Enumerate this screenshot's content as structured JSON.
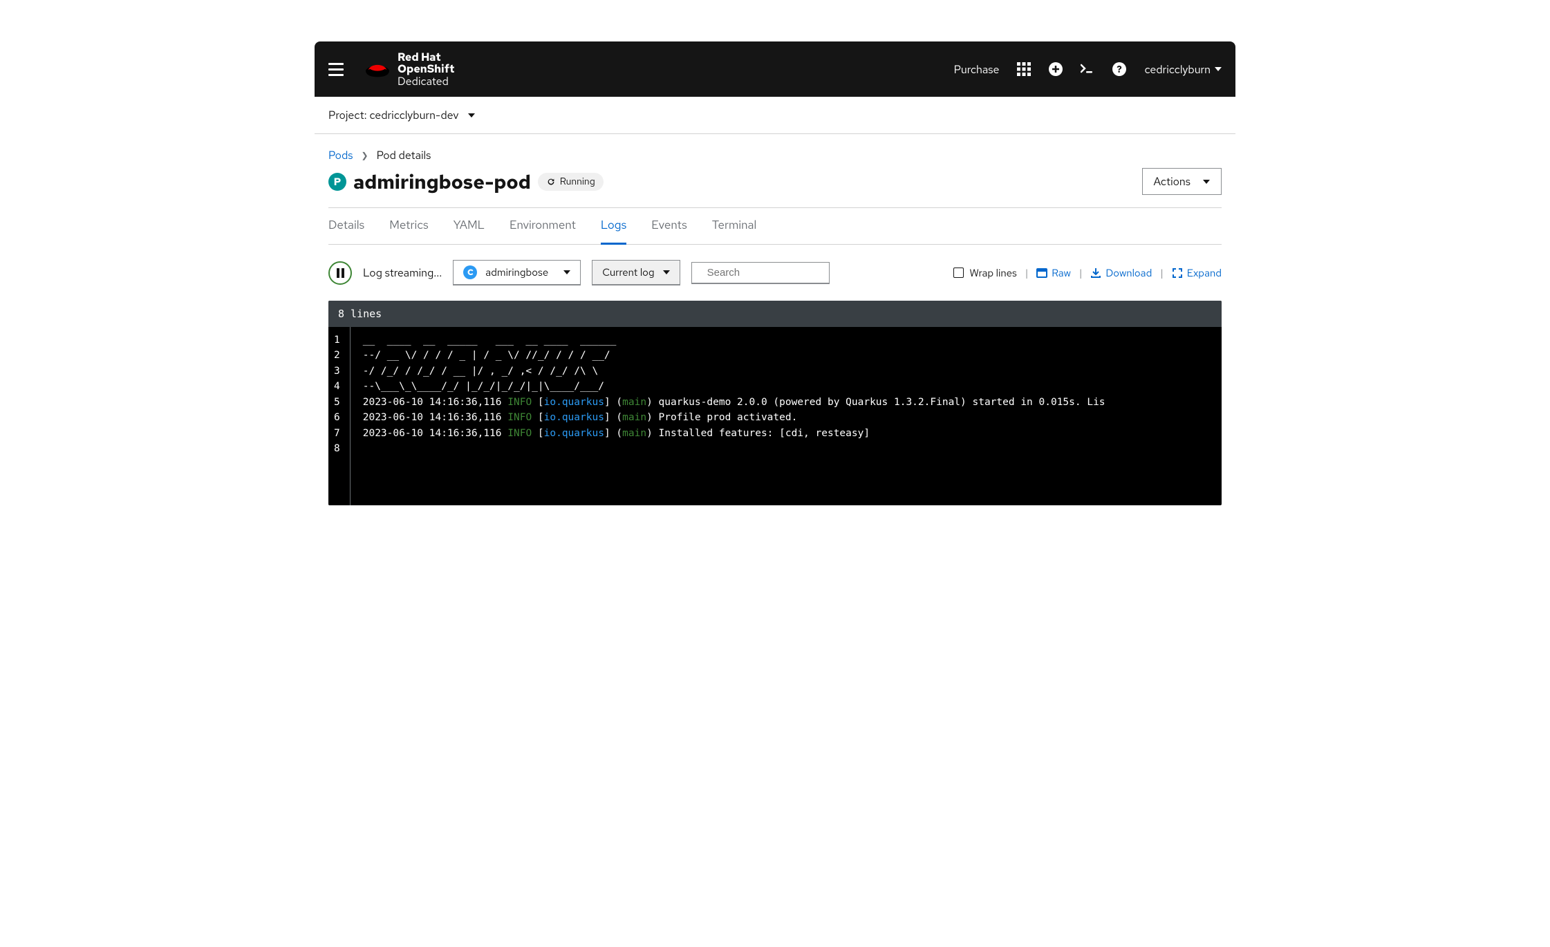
{
  "masthead": {
    "brand_l1": "Red Hat",
    "brand_l2": "OpenShift",
    "brand_l3": "Dedicated",
    "purchase": "Purchase",
    "username": "cedricclyburn"
  },
  "project": {
    "label": "Project: cedricclyburn-dev"
  },
  "breadcrumb": {
    "root": "Pods",
    "current": "Pod details"
  },
  "heading": {
    "badge": "P",
    "title": "admiringbose-pod",
    "status": "Running",
    "actions": "Actions"
  },
  "tabs": {
    "details": "Details",
    "metrics": "Metrics",
    "yaml": "YAML",
    "environment": "Environment",
    "logs": "Logs",
    "events": "Events",
    "terminal": "Terminal"
  },
  "log_toolbar": {
    "streaming": "Log streaming...",
    "container_badge": "C",
    "container_name": "admiringbose",
    "current_log": "Current log",
    "search_placeholder": "Search",
    "wrap": "Wrap lines",
    "raw": "Raw",
    "download": "Download",
    "expand": "Expand"
  },
  "log": {
    "line_count_label": "8 lines",
    "lines": [
      {
        "n": "1",
        "segments": [
          {
            "cls": "tok-plain",
            "t": "__  ____  __  _____   ___  __ ____  ______"
          }
        ]
      },
      {
        "n": "2",
        "segments": [
          {
            "cls": "tok-plain",
            "t": "--/ __ \\/ / / / _ | / _ \\/ //_/ / / / __/"
          }
        ]
      },
      {
        "n": "3",
        "segments": [
          {
            "cls": "tok-plain",
            "t": "-/ /_/ / /_/ / __ |/ , _/ ,< / /_/ /\\ \\"
          }
        ]
      },
      {
        "n": "4",
        "segments": [
          {
            "cls": "tok-plain",
            "t": "--\\___\\_\\____/_/ |_/_/|_/_/|_|\\____/___/"
          }
        ]
      },
      {
        "n": "5",
        "segments": [
          {
            "cls": "tok-plain",
            "t": "2023-06-10 14:16:36,116 "
          },
          {
            "cls": "tok-info",
            "t": "INFO "
          },
          {
            "cls": "tok-plain",
            "t": "["
          },
          {
            "cls": "tok-src",
            "t": "io.quarkus"
          },
          {
            "cls": "tok-plain",
            "t": "] ("
          },
          {
            "cls": "tok-main",
            "t": "main"
          },
          {
            "cls": "tok-plain",
            "t": ") quarkus-demo 2.0.0 (powered by Quarkus 1.3.2.Final) started in 0.015s. Lis"
          }
        ]
      },
      {
        "n": "6",
        "segments": [
          {
            "cls": "tok-plain",
            "t": "2023-06-10 14:16:36,116 "
          },
          {
            "cls": "tok-info",
            "t": "INFO "
          },
          {
            "cls": "tok-plain",
            "t": "["
          },
          {
            "cls": "tok-src",
            "t": "io.quarkus"
          },
          {
            "cls": "tok-plain",
            "t": "] ("
          },
          {
            "cls": "tok-main",
            "t": "main"
          },
          {
            "cls": "tok-plain",
            "t": ") Profile prod activated."
          }
        ]
      },
      {
        "n": "7",
        "segments": [
          {
            "cls": "tok-plain",
            "t": "2023-06-10 14:16:36,116 "
          },
          {
            "cls": "tok-info",
            "t": "INFO "
          },
          {
            "cls": "tok-plain",
            "t": "["
          },
          {
            "cls": "tok-src",
            "t": "io.quarkus"
          },
          {
            "cls": "tok-plain",
            "t": "] ("
          },
          {
            "cls": "tok-main",
            "t": "main"
          },
          {
            "cls": "tok-plain",
            "t": ") Installed features: [cdi, resteasy]"
          }
        ]
      },
      {
        "n": "8",
        "segments": [
          {
            "cls": "tok-plain",
            "t": ""
          }
        ]
      }
    ]
  }
}
